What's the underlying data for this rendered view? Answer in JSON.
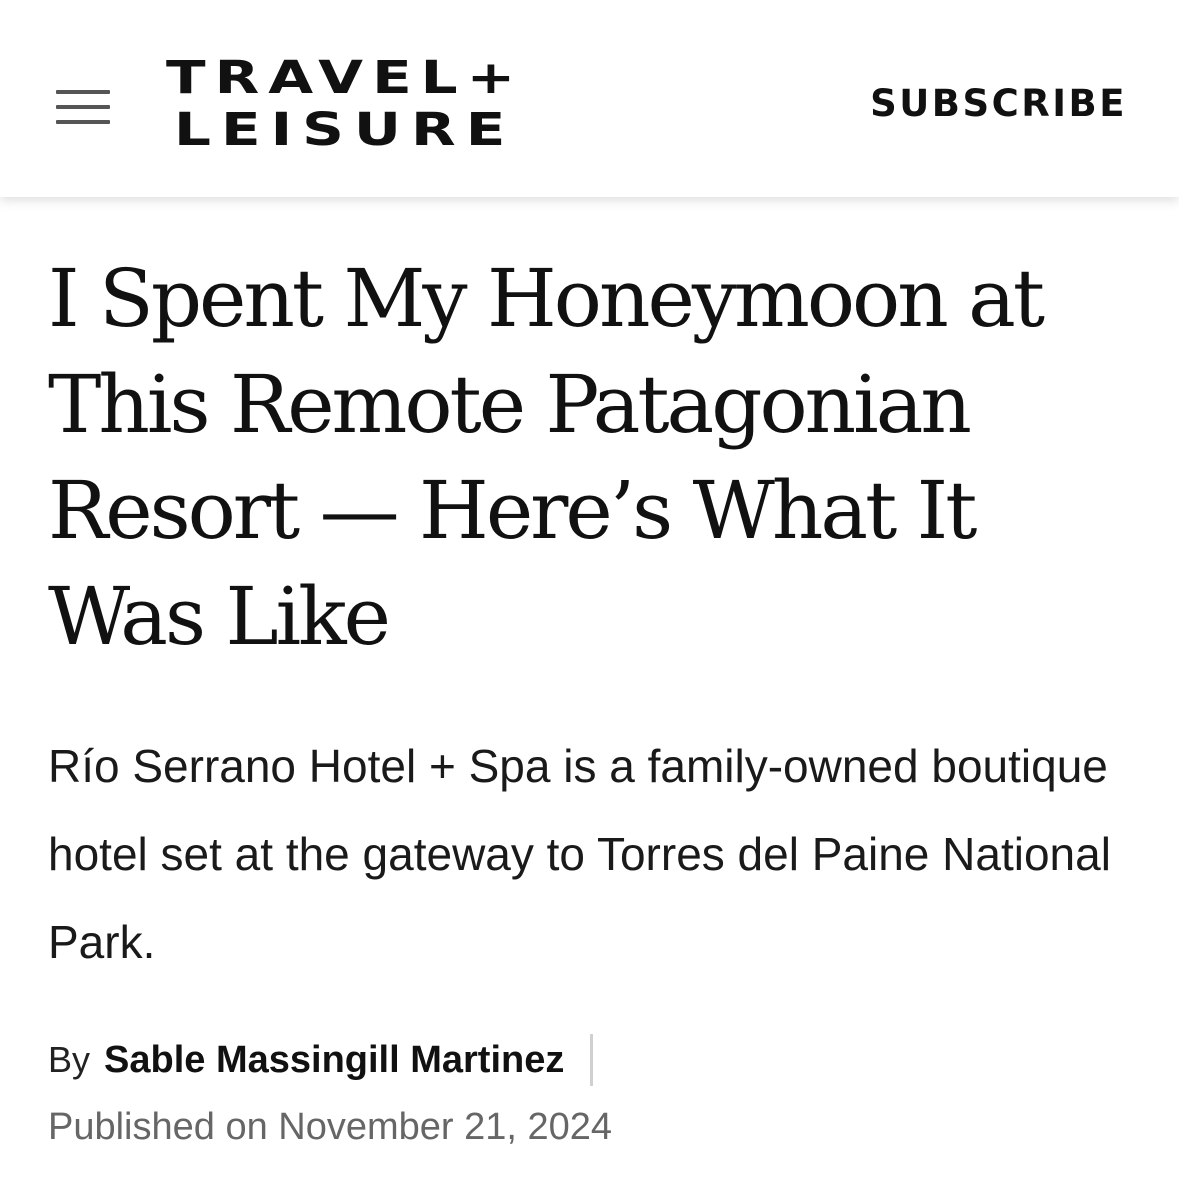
{
  "header": {
    "menu_icon": "hamburger-menu-icon",
    "logo": {
      "line1": "TRAVEL+",
      "line2": "LEISURE"
    },
    "subscribe_label": "SUBSCRIBE"
  },
  "article": {
    "headline": "I Spent My Honeymoon at This Remote Patagonian Resort — Here’s What It Was Like",
    "dek": "Río Serrano Hotel + Spa is a family-owned boutique hotel set at the gateway to Torres del Paine National Park.",
    "byline": {
      "prefix": "By",
      "author": "Sable Massingill Martinez"
    },
    "published": "Published on November 21, 2024"
  }
}
